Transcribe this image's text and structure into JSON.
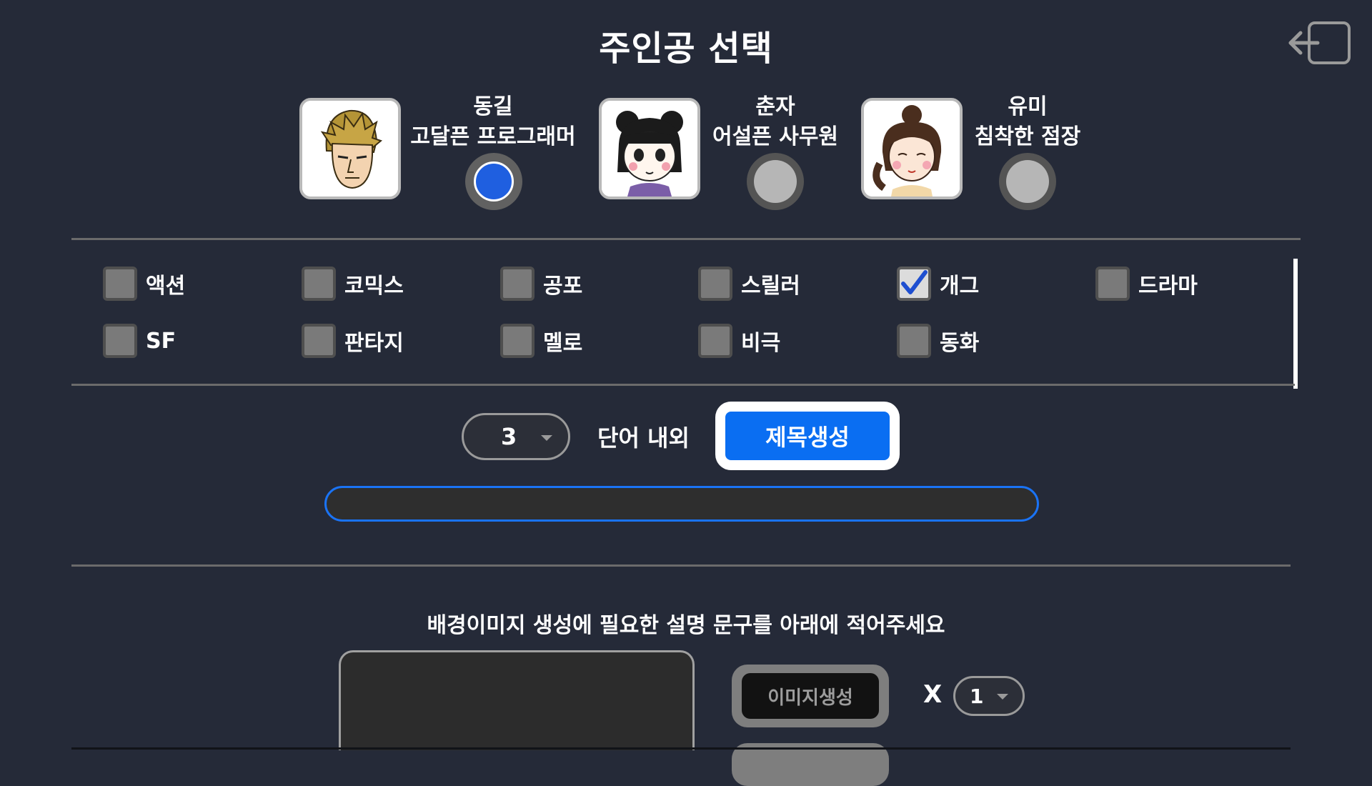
{
  "page": {
    "title": "주인공 선택",
    "exit_icon": "exit-icon"
  },
  "characters": [
    {
      "name": "동길",
      "description": "고달픈 프로그래머",
      "selected": true,
      "avatar_icon": "man-avatar-icon"
    },
    {
      "name": "춘자",
      "description": "어설픈 사무원",
      "selected": false,
      "avatar_icon": "girl-avatar-icon"
    },
    {
      "name": "유미",
      "description": "침착한 점장",
      "selected": false,
      "avatar_icon": "woman-avatar-icon"
    }
  ],
  "genres": [
    {
      "label": "액션",
      "checked": false
    },
    {
      "label": "코믹스",
      "checked": false
    },
    {
      "label": "공포",
      "checked": false
    },
    {
      "label": "스릴러",
      "checked": false
    },
    {
      "label": "개그",
      "checked": true
    },
    {
      "label": "드라마",
      "checked": false
    },
    {
      "label": "SF",
      "checked": false
    },
    {
      "label": "판타지",
      "checked": false
    },
    {
      "label": "멜로",
      "checked": false
    },
    {
      "label": "비극",
      "checked": false
    },
    {
      "label": "동화",
      "checked": false
    }
  ],
  "title_gen": {
    "word_count": "3",
    "word_label": "단어 내외",
    "button_label": "제목생성",
    "output_value": ""
  },
  "image_gen": {
    "prompt_label": "배경이미지 생성에 필요한 설명 문구를 아래에 적어주세요",
    "description_value": "",
    "button_label": "이미지생성",
    "multiplier_label": "X",
    "count": "1"
  },
  "colors": {
    "background": "#252a38",
    "accent": "#0a6ef2",
    "radio_selected": "#1f5fe0",
    "check_mark": "#1f4fd0"
  }
}
